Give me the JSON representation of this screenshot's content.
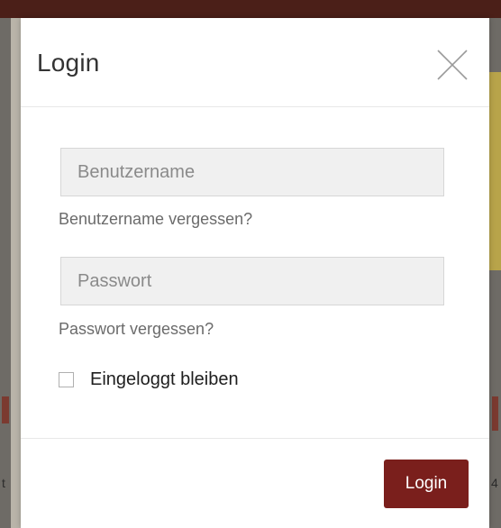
{
  "modal": {
    "title": "Login",
    "close_icon": "close-icon"
  },
  "form": {
    "username": {
      "value": "",
      "placeholder": "Benutzername"
    },
    "forgot_username_label": "Benutzername vergessen?",
    "password": {
      "value": "",
      "placeholder": "Passwort"
    },
    "forgot_password_label": "Passwort vergessen?",
    "remember_me": {
      "label": "Eingeloggt bleiben",
      "checked": false
    }
  },
  "footer": {
    "login_label": "Login"
  },
  "background": {
    "left_text": "t",
    "right_text": "4"
  },
  "colors": {
    "primary_button": "#7a1f1c",
    "topbar": "#4b1f18",
    "backdrop": "#b9b4a9"
  }
}
